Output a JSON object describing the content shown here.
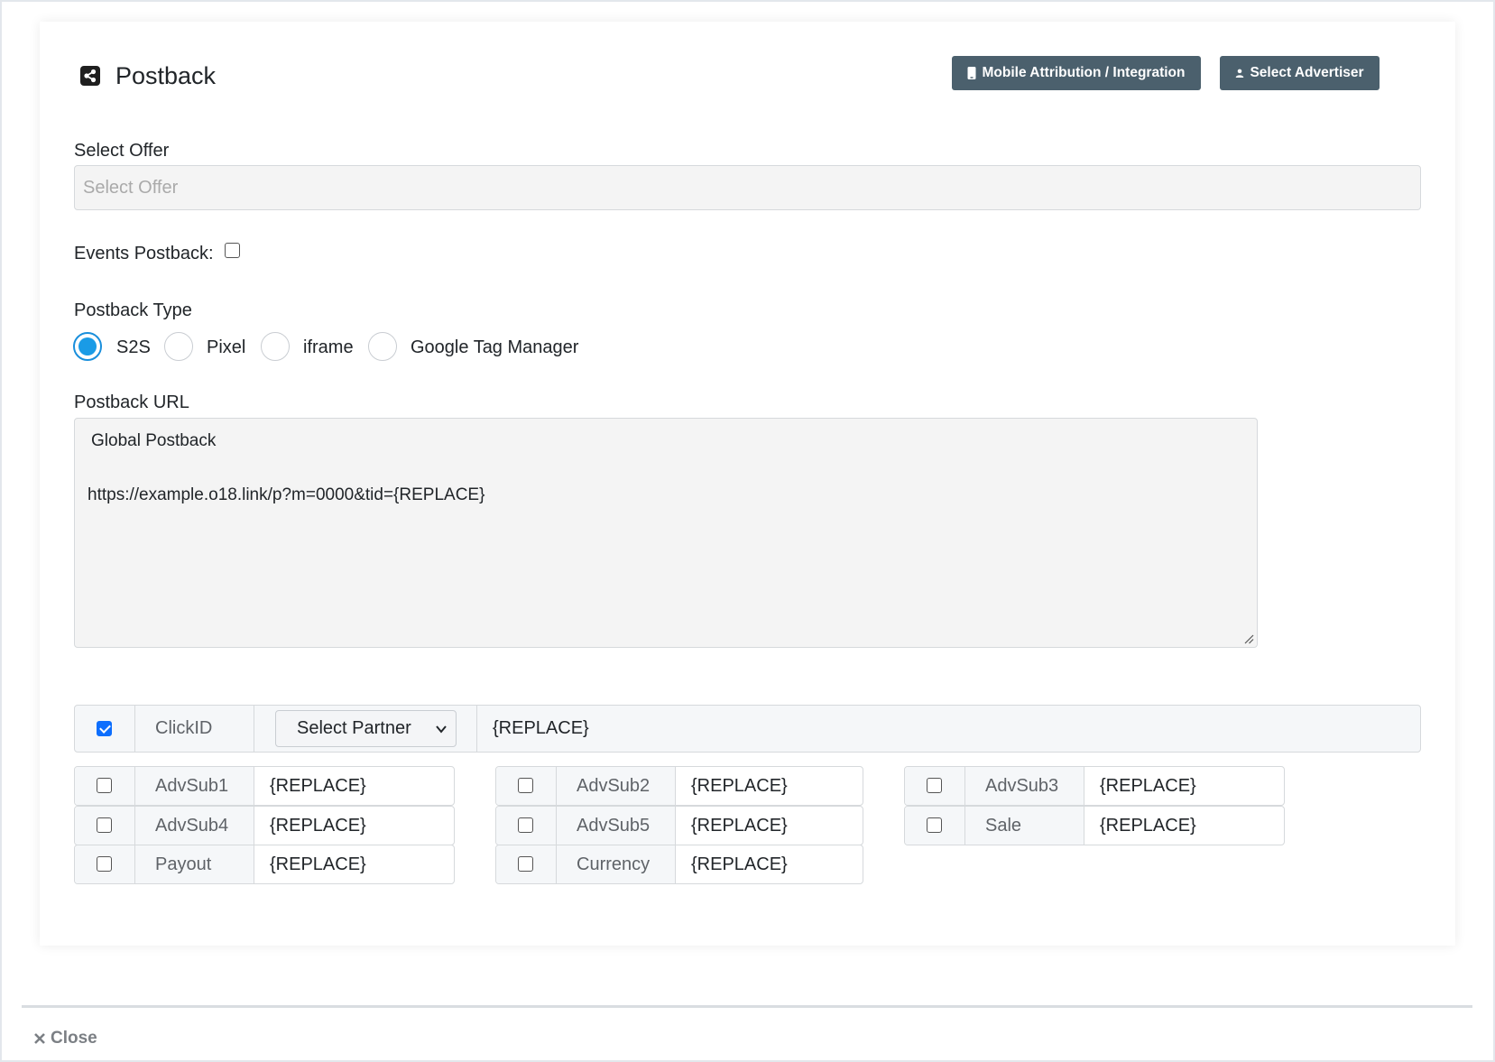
{
  "header": {
    "title": "Postback",
    "icon": "share-icon",
    "mobile_button": "Mobile Attribution / Integration",
    "advertiser_button": "Select Advertiser"
  },
  "offer": {
    "label": "Select Offer",
    "placeholder": "Select Offer"
  },
  "events": {
    "label": "Events Postback:",
    "checked": false
  },
  "postback_type": {
    "label": "Postback Type",
    "options": [
      "S2S",
      "Pixel",
      "iframe",
      "Google Tag Manager"
    ],
    "selected": "S2S"
  },
  "postback_url": {
    "label": "Postback URL",
    "line1": "Global Postback",
    "line2": "https://example.o18.link/p?m=0000&tid={REPLACE}"
  },
  "clickid": {
    "name": "ClickID",
    "checked": true,
    "partner": "Select Partner",
    "value": "{REPLACE}"
  },
  "params": [
    {
      "name": "AdvSub1",
      "value": "{REPLACE}",
      "checked": false
    },
    {
      "name": "AdvSub2",
      "value": "{REPLACE}",
      "checked": false
    },
    {
      "name": "AdvSub3",
      "value": "{REPLACE}",
      "checked": false
    },
    {
      "name": "AdvSub4",
      "value": "{REPLACE}",
      "checked": false
    },
    {
      "name": "AdvSub5",
      "value": "{REPLACE}",
      "checked": false
    },
    {
      "name": "Sale",
      "value": "{REPLACE}",
      "checked": false
    },
    {
      "name": "Payout",
      "value": "{REPLACE}",
      "checked": false
    },
    {
      "name": "Currency",
      "value": "{REPLACE}",
      "checked": false
    }
  ],
  "footer": {
    "close_label": "Close"
  },
  "colors": {
    "button": "#4b606d",
    "radio_selected": "#1a9be6",
    "checkbox_checked": "#0d6efd"
  }
}
